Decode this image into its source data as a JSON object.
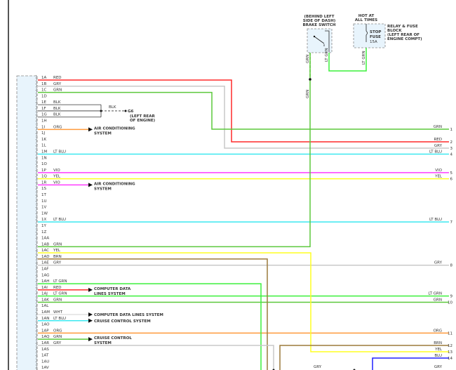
{
  "colors": {
    "RED": "#ff2a2a",
    "GRY": "#c8c8c8",
    "GRN": "#5cc83c",
    "BLK": "#333333",
    "ORG": "#ff9a3c",
    "LT BLU": "#3ce8f0",
    "VIO": "#ff3cff",
    "YEL": "#ffff20",
    "BRN": "#9c7a3c",
    "LT GRN": "#3cf03c",
    "WHT": "#e0e0e0",
    "BLU": "#2020ff",
    "connector_fill": "#e8f4fc"
  },
  "pins": [
    {
      "id": "1A",
      "wire": "RED"
    },
    {
      "id": "1B",
      "wire": "GRY"
    },
    {
      "id": "1C",
      "wire": "GRN"
    },
    {
      "id": "1D",
      "wire": ""
    },
    {
      "id": "1E",
      "wire": "BLK"
    },
    {
      "id": "1F",
      "wire": "BLK"
    },
    {
      "id": "1G",
      "wire": "BLK"
    },
    {
      "id": "1H",
      "wire": ""
    },
    {
      "id": "1I",
      "wire": "ORG"
    },
    {
      "id": "1J",
      "wire": ""
    },
    {
      "id": "1K",
      "wire": ""
    },
    {
      "id": "1L",
      "wire": ""
    },
    {
      "id": "1M",
      "wire": "LT BLU"
    },
    {
      "id": "1N",
      "wire": ""
    },
    {
      "id": "1O",
      "wire": ""
    },
    {
      "id": "1P",
      "wire": "VIO"
    },
    {
      "id": "1Q",
      "wire": "YEL"
    },
    {
      "id": "1R",
      "wire": "VIO"
    },
    {
      "id": "1S",
      "wire": ""
    },
    {
      "id": "1T",
      "wire": ""
    },
    {
      "id": "1U",
      "wire": ""
    },
    {
      "id": "1V",
      "wire": ""
    },
    {
      "id": "1W",
      "wire": ""
    },
    {
      "id": "1X",
      "wire": "LT BLU"
    },
    {
      "id": "1Y",
      "wire": ""
    },
    {
      "id": "1Z",
      "wire": ""
    },
    {
      "id": "1AA",
      "wire": ""
    },
    {
      "id": "1AB",
      "wire": "GRN"
    },
    {
      "id": "1AC",
      "wire": "YEL"
    },
    {
      "id": "1AD",
      "wire": "BRN"
    },
    {
      "id": "1AE",
      "wire": "GRY"
    },
    {
      "id": "1AF",
      "wire": ""
    },
    {
      "id": "1AG",
      "wire": ""
    },
    {
      "id": "1AH",
      "wire": "LT GRN"
    },
    {
      "id": "1AI",
      "wire": "RED"
    },
    {
      "id": "1AJ",
      "wire": "LT GRN"
    },
    {
      "id": "1AK",
      "wire": "GRN"
    },
    {
      "id": "1AL",
      "wire": ""
    },
    {
      "id": "1AM",
      "wire": "WHT"
    },
    {
      "id": "1AN",
      "wire": "LT BLU"
    },
    {
      "id": "1AO",
      "wire": ""
    },
    {
      "id": "1AP",
      "wire": "ORG"
    },
    {
      "id": "1AQ",
      "wire": "GRN"
    },
    {
      "id": "1AR",
      "wire": "GRY"
    },
    {
      "id": "1AS",
      "wire": ""
    },
    {
      "id": "1AT",
      "wire": ""
    },
    {
      "id": "1AU",
      "wire": ""
    },
    {
      "id": "1AV",
      "wire": ""
    }
  ],
  "outputs": [
    {
      "num": "1",
      "label": "GRN"
    },
    {
      "num": "2",
      "label": "RED"
    },
    {
      "num": "3",
      "label": "GRY"
    },
    {
      "num": "4",
      "label": "LT BLU"
    },
    {
      "num": "5",
      "label": "VIO"
    },
    {
      "num": "6",
      "label": "YEL"
    },
    {
      "num": "7",
      "label": "LT BLU"
    },
    {
      "num": "8",
      "label": "GRY"
    },
    {
      "num": "9",
      "label": "LT GRN"
    },
    {
      "num": "10",
      "label": "GRN"
    },
    {
      "num": "11",
      "label": "ORG"
    },
    {
      "num": "12",
      "label": "BRN"
    },
    {
      "num": "13",
      "label": "YEL"
    },
    {
      "num": "14",
      "label": "BLU"
    },
    {
      "num": "15",
      "label": "GRY"
    }
  ],
  "ground": {
    "label": "BLK",
    "name": "G6",
    "location_1": "(LEFT REAR",
    "location_2": "OF ENGINE)"
  },
  "destinations": {
    "ac_1": "AIR CONDITIONING",
    "ac_2": "SYSTEM",
    "cdl_1": "COMPUTER DATA",
    "cdl_2": "LINES SYSTEM",
    "cdl_single": "COMPUTER DATA LINES SYSTEM",
    "cruise_single": "CRUISE CONTROL SYSTEM",
    "cruise_1": "CRUISE CONTROL",
    "cruise_2": "SYSTEM"
  },
  "brake_switch": {
    "loc_1": "(BEHIND LEFT",
    "loc_2": "SIDE OF DASH)",
    "name": "BRAKE SWITCH",
    "wire_a": "GRN",
    "wire_b": "LT GRN",
    "wire_below": "GRN"
  },
  "fuse": {
    "hot_1": "HOT AT",
    "hot_2": "ALL TIMES",
    "name_1": "STOP",
    "name_2": "FUSE",
    "rating": "15A",
    "wire": "LT GRN",
    "block_1": "RELAY & FUSE",
    "block_2": "BLOCK",
    "block_3": "(LEFT REAR OF",
    "block_4": "ENGINE COMPT)"
  },
  "bottom_labels": {
    "a": "GRY",
    "b": "GRY"
  }
}
